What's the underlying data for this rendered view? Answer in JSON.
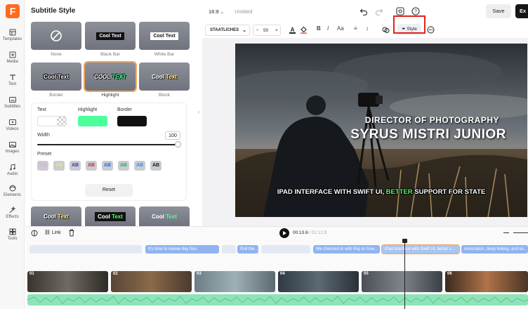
{
  "rail": {
    "items": [
      {
        "label": "Templates",
        "icon": "templates-icon"
      },
      {
        "label": "Media",
        "icon": "media-icon"
      },
      {
        "label": "Text",
        "icon": "text-icon"
      },
      {
        "label": "Subtitles",
        "icon": "subtitles-icon"
      },
      {
        "label": "Videos",
        "icon": "videos-icon"
      },
      {
        "label": "Images",
        "icon": "images-icon"
      },
      {
        "label": "Audio",
        "icon": "audio-icon"
      },
      {
        "label": "Elements",
        "icon": "elements-icon"
      },
      {
        "label": "Effects",
        "icon": "effects-icon"
      },
      {
        "label": "Tools",
        "icon": "tools-icon"
      }
    ]
  },
  "panel": {
    "title": "Subtitle Style",
    "styles": [
      {
        "label": "None",
        "sample": ""
      },
      {
        "label": "Black Bar",
        "sample": "Cool Text"
      },
      {
        "label": "White Bar",
        "sample": "Cool Text"
      },
      {
        "label": "Border",
        "sample": "Cool Text"
      },
      {
        "label": "Highlight",
        "sample_a": "COOL ",
        "sample_b": "TEXT"
      },
      {
        "label": "Block",
        "sample_a": "Cool ",
        "sample_b": "Text"
      }
    ],
    "more_styles": [
      {
        "sample_a": "Cool ",
        "sample_b": "Text"
      },
      {
        "sample_a": "Cool ",
        "sample_b": "Text"
      },
      {
        "sample_a": "Cool ",
        "sample_b": "Text"
      }
    ],
    "editor": {
      "text_label": "Text",
      "highlight_label": "Highlight",
      "border_label": "Border",
      "width_label": "Width",
      "width_value": "100",
      "preset_label": "Preset",
      "presets": [
        "AB",
        "AB",
        "AB",
        "AB",
        "AB",
        "AB",
        "AB",
        "AB"
      ],
      "reset_label": "Reset"
    },
    "colors": {
      "highlight": "#4cff9a",
      "border": "#111111",
      "accent": "#f0a55e"
    }
  },
  "header": {
    "ratio": "16:9",
    "title": "Untitled",
    "save_label": "Save",
    "export_label": "Ex"
  },
  "toolbar": {
    "font": "STAATLICHES",
    "font_size": "50",
    "style_label": "Style"
  },
  "video": {
    "role": "DIRECTOR OF PHOTOGRAPHY",
    "name": "SYRUS MISTRI JUNIOR",
    "caption_a": "IPAD INTERFACE WITH SWIFT UI, ",
    "caption_hl": "BETTER",
    "caption_b": " SUPPORT FOR STATE"
  },
  "timeline": {
    "link_label": "Link",
    "current_time": "00:13.6",
    "total_time": "01:12.8",
    "subtitles": [
      "It's time to review day four.",
      "Roll the ...",
      "We checked in with Raj on how...",
      "iPad interface with Swift UI, better s...",
      "restoration, deep linking, and ev..."
    ],
    "clips": [
      "01",
      "02",
      "03",
      "04",
      "05",
      "06"
    ]
  }
}
